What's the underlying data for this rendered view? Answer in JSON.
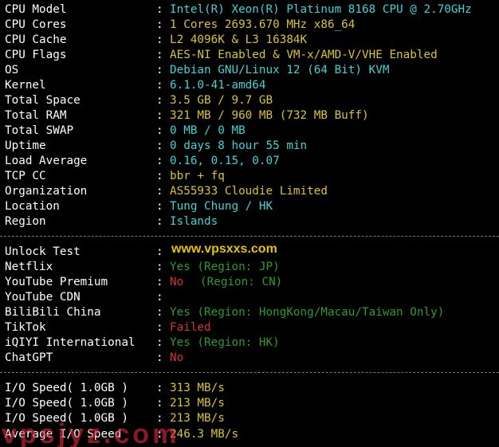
{
  "system": [
    {
      "label": "CPU Model",
      "value": "Intel(R) Xeon(R) Platinum 8168 CPU @ 2.70GHz",
      "color": "cyan"
    },
    {
      "label": "CPU Cores",
      "value": "1 Cores 2693.670 MHz x86_64",
      "color": "yellow"
    },
    {
      "label": "CPU Cache",
      "value": "L2 4096K & L3 16384K",
      "color": "yellow"
    },
    {
      "label": "CPU Flags",
      "value": "AES-NI Enabled & VM-x/AMD-V/VHE Enabled",
      "color": "yellow"
    },
    {
      "label": "OS",
      "value": "Debian GNU/Linux 12 (64 Bit) KVM",
      "color": "cyan"
    },
    {
      "label": "Kernel",
      "value": "6.1.0-41-amd64",
      "color": "cyan"
    },
    {
      "label": "Total Space",
      "value": "3.5 GB / 9.7 GB",
      "color": "yellow"
    },
    {
      "label": "Total RAM",
      "value": "321 MB / 960 MB (732 MB Buff)",
      "color": "yellow"
    },
    {
      "label": "Total SWAP",
      "value": "0 MB / 0 MB",
      "color": "cyan"
    },
    {
      "label": "Uptime",
      "value": "0 days 8 hour 55 min",
      "color": "cyan"
    },
    {
      "label": "Load Average",
      "value": "0.16, 0.15, 0.07",
      "color": "cyan"
    },
    {
      "label": "TCP CC",
      "value": "bbr + fq",
      "color": "yellow"
    },
    {
      "label": "Organization",
      "value": "AS55933 Cloudie Limited",
      "color": "yellow"
    },
    {
      "label": "Location",
      "value": "Tung Chung / HK",
      "color": "cyan"
    },
    {
      "label": "Region",
      "value": "Islands",
      "color": "cyan"
    }
  ],
  "unlock": {
    "header": "Unlock Test",
    "rows": [
      {
        "label": "Netflix",
        "value": "Yes (Region: JP)",
        "color": "green"
      },
      {
        "label": "YouTube Premium",
        "value": "No",
        "color": "red",
        "extra": "(Region: CN)",
        "extra_color": "green"
      },
      {
        "label": "YouTube CDN",
        "value": "",
        "color": "white"
      },
      {
        "label": "BiliBili China",
        "value": "Yes (Region: HongKong/Macau/Taiwan Only)",
        "color": "green"
      },
      {
        "label": "TikTok",
        "value": "Failed",
        "color": "red"
      },
      {
        "label": "iQIYI International",
        "value": "Yes (Region: HK)",
        "color": "green"
      },
      {
        "label": "ChatGPT",
        "value": "No",
        "color": "red"
      }
    ]
  },
  "io": [
    {
      "label": "I/O Speed( 1.0GB )",
      "value": "313 MB/s"
    },
    {
      "label": "I/O Speed( 1.0GB )",
      "value": "213 MB/s"
    },
    {
      "label": "I/O Speed( 1.0GB )",
      "value": "213 MB/s"
    },
    {
      "label": "Average I/O Speed",
      "value": "246.3 MB/s"
    }
  ],
  "separator": ":",
  "watermark_top": "www.vpsxxs.com",
  "watermark_bottom": "vpsjyz.com",
  "colors": {
    "background": "#000000",
    "label": "#ffffff",
    "cyan": "#3fd3d3",
    "yellow": "#d6c435",
    "green": "#2e9a2e",
    "red": "#d63232"
  }
}
